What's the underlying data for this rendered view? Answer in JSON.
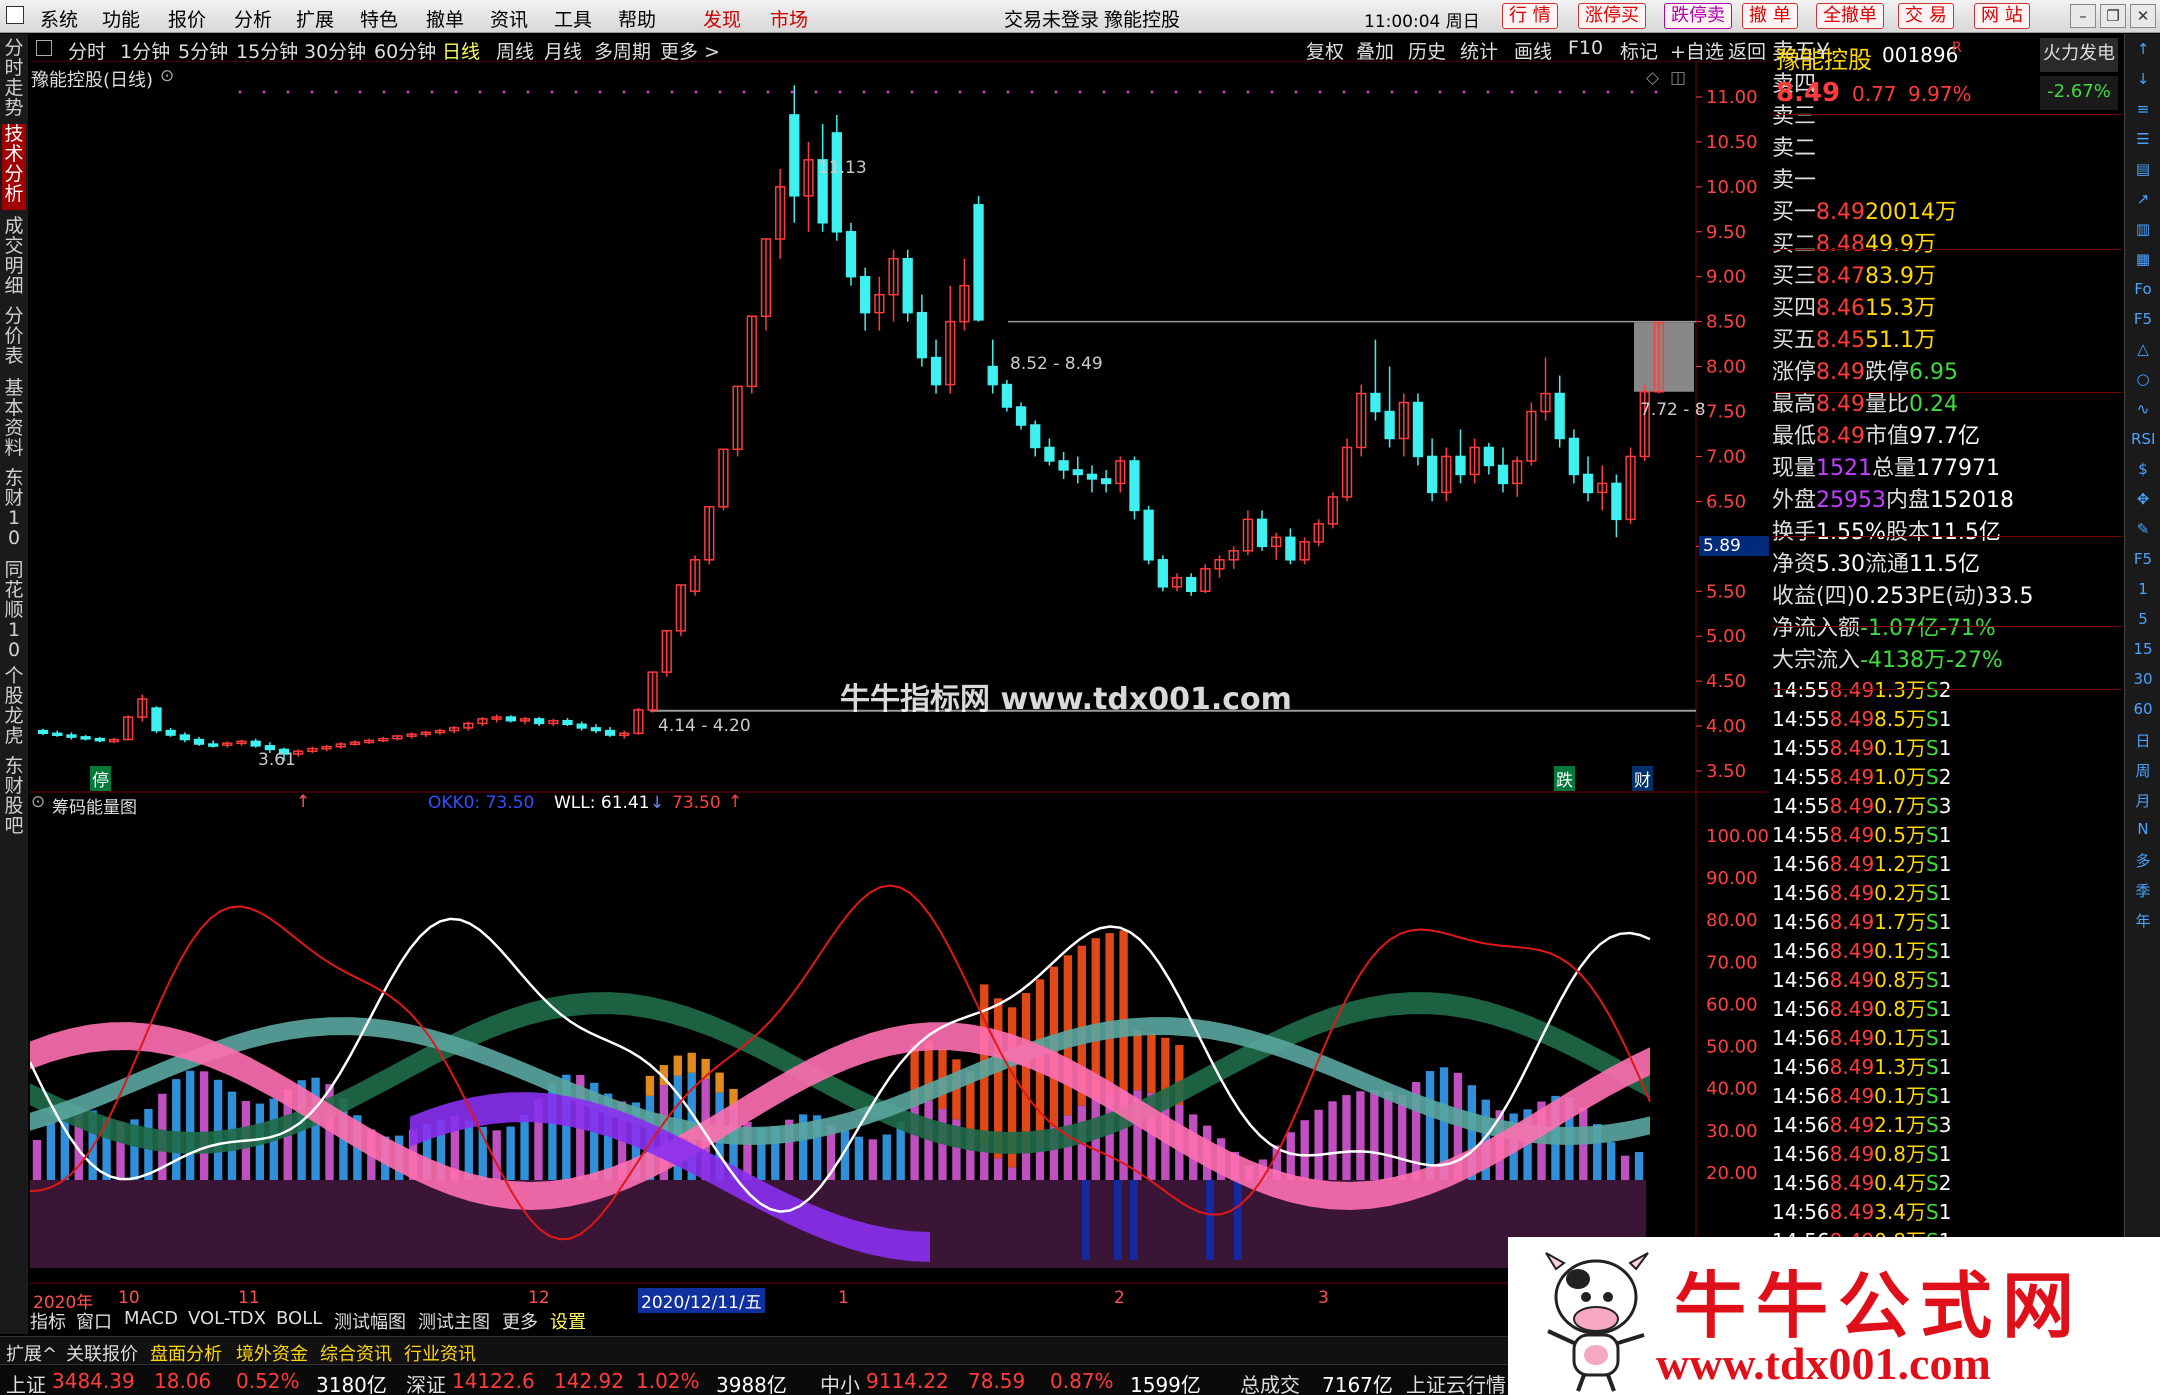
{
  "menu": {
    "items": [
      "系统",
      "功能",
      "报价",
      "分析",
      "扩展",
      "特色",
      "撤单",
      "资讯",
      "工具",
      "帮助"
    ],
    "discover": "发现",
    "market": "市场",
    "login": "交易未登录",
    "stock_name_title": "豫能控股",
    "clock": "11:00:04 周日",
    "quick": [
      "行 情",
      "涨停买",
      "跌停卖",
      "撤 单",
      "全撤单",
      "交 易",
      "网 站"
    ]
  },
  "leftbar": [
    "分时走势",
    "技术分析",
    "成交明细",
    "分价表",
    "基本资料",
    "东财10",
    "同花顺10",
    "个股龙虎",
    "东财股吧"
  ],
  "periods": [
    "分时",
    "1分钟",
    "5分钟",
    "15分钟",
    "30分钟",
    "60分钟",
    "日线",
    "周线",
    "月线",
    "多周期",
    "更多 >"
  ],
  "chart_tools": [
    "复权",
    "叠加",
    "历史",
    "统计",
    "画线",
    "F10",
    "标记",
    "+自选",
    "返回"
  ],
  "main_chart": {
    "title": "豫能控股(日线)",
    "ylabels": [
      "11.00",
      "10.50",
      "10.00",
      "9.50",
      "9.00",
      "8.50",
      "8.00",
      "7.50",
      "7.00",
      "6.50",
      "6.00",
      "5.50",
      "5.00",
      "4.50",
      "4.00",
      "3.50"
    ],
    "annotations": {
      "high": "11.13",
      "low": "3.61",
      "range1": "8.52 - 8.49",
      "range2": "4.14 - 4.20",
      "range3": "7.72 - 8",
      "marker": "5.89",
      "flag1": "停",
      "flag2": "跌",
      "flag3": "财"
    },
    "watermark": "牛牛指标网 www.tdx001.com"
  },
  "chart_data": {
    "type": "candlestick",
    "candles": [
      [
        3.95,
        3.97,
        3.9,
        3.92
      ],
      [
        3.92,
        3.95,
        3.88,
        3.9
      ],
      [
        3.9,
        3.93,
        3.85,
        3.88
      ],
      [
        3.88,
        3.9,
        3.84,
        3.86
      ],
      [
        3.86,
        3.88,
        3.82,
        3.84
      ],
      [
        3.84,
        3.87,
        3.81,
        3.85
      ],
      [
        3.85,
        4.12,
        3.84,
        4.1
      ],
      [
        4.1,
        4.35,
        4.05,
        4.3
      ],
      [
        4.2,
        4.22,
        3.92,
        3.95
      ],
      [
        3.95,
        3.98,
        3.88,
        3.9
      ],
      [
        3.9,
        3.93,
        3.82,
        3.85
      ],
      [
        3.85,
        3.88,
        3.78,
        3.8
      ],
      [
        3.8,
        3.84,
        3.76,
        3.79
      ],
      [
        3.79,
        3.83,
        3.76,
        3.81
      ],
      [
        3.81,
        3.85,
        3.78,
        3.83
      ],
      [
        3.83,
        3.86,
        3.76,
        3.78
      ],
      [
        3.78,
        3.82,
        3.7,
        3.74
      ],
      [
        3.74,
        3.76,
        3.61,
        3.69
      ],
      [
        3.69,
        3.74,
        3.66,
        3.72
      ],
      [
        3.72,
        3.77,
        3.7,
        3.75
      ],
      [
        3.75,
        3.79,
        3.72,
        3.77
      ],
      [
        3.77,
        3.82,
        3.75,
        3.8
      ],
      [
        3.8,
        3.84,
        3.78,
        3.82
      ],
      [
        3.82,
        3.86,
        3.8,
        3.84
      ],
      [
        3.84,
        3.88,
        3.82,
        3.86
      ],
      [
        3.86,
        3.9,
        3.84,
        3.89
      ],
      [
        3.89,
        3.93,
        3.86,
        3.91
      ],
      [
        3.91,
        3.95,
        3.88,
        3.93
      ],
      [
        3.93,
        3.97,
        3.9,
        3.95
      ],
      [
        3.95,
        4.0,
        3.92,
        3.98
      ],
      [
        3.98,
        4.05,
        3.95,
        4.03
      ],
      [
        4.03,
        4.1,
        4.0,
        4.08
      ],
      [
        4.08,
        4.13,
        4.04,
        4.1
      ],
      [
        4.1,
        4.12,
        4.04,
        4.06
      ],
      [
        4.06,
        4.1,
        4.02,
        4.08
      ],
      [
        4.08,
        4.1,
        4.0,
        4.03
      ],
      [
        4.03,
        4.08,
        4.0,
        4.06
      ],
      [
        4.06,
        4.09,
        4.0,
        4.02
      ],
      [
        4.02,
        4.05,
        3.95,
        3.98
      ],
      [
        3.98,
        4.02,
        3.92,
        3.95
      ],
      [
        3.95,
        3.99,
        3.88,
        3.9
      ],
      [
        3.9,
        3.95,
        3.86,
        3.92
      ],
      [
        3.92,
        4.2,
        3.9,
        4.18
      ],
      [
        4.18,
        4.6,
        4.15,
        4.6
      ],
      [
        4.6,
        5.06,
        4.55,
        5.06
      ],
      [
        5.06,
        5.57,
        5.0,
        5.57
      ],
      [
        5.5,
        5.9,
        5.45,
        5.85
      ],
      [
        5.85,
        6.44,
        5.8,
        6.44
      ],
      [
        6.44,
        7.08,
        6.4,
        7.08
      ],
      [
        7.08,
        7.78,
        7.0,
        7.78
      ],
      [
        7.78,
        8.56,
        7.7,
        8.56
      ],
      [
        8.56,
        9.42,
        8.4,
        9.42
      ],
      [
        9.42,
        10.2,
        9.2,
        10.0
      ],
      [
        10.8,
        11.13,
        9.6,
        9.9
      ],
      [
        9.9,
        10.5,
        9.5,
        10.3
      ],
      [
        10.3,
        10.7,
        9.5,
        9.6
      ],
      [
        10.6,
        10.8,
        9.4,
        9.5
      ],
      [
        9.5,
        9.6,
        8.9,
        9.0
      ],
      [
        9.0,
        9.1,
        8.4,
        8.6
      ],
      [
        8.6,
        9.0,
        8.4,
        8.8
      ],
      [
        8.8,
        9.3,
        8.5,
        9.2
      ],
      [
        9.2,
        9.3,
        8.5,
        8.6
      ],
      [
        8.6,
        8.8,
        8.0,
        8.1
      ],
      [
        8.1,
        8.3,
        7.7,
        7.8
      ],
      [
        7.8,
        8.9,
        7.7,
        8.5
      ],
      [
        8.5,
        9.2,
        8.4,
        8.9
      ],
      [
        9.8,
        9.9,
        8.5,
        8.52
      ],
      [
        8.0,
        8.3,
        7.7,
        7.8
      ],
      [
        7.8,
        7.85,
        7.5,
        7.55
      ],
      [
        7.55,
        7.6,
        7.3,
        7.35
      ],
      [
        7.35,
        7.4,
        7.0,
        7.1
      ],
      [
        7.1,
        7.2,
        6.9,
        6.95
      ],
      [
        6.95,
        7.05,
        6.75,
        6.85
      ],
      [
        6.85,
        7.0,
        6.7,
        6.8
      ],
      [
        6.8,
        6.9,
        6.6,
        6.75
      ],
      [
        6.75,
        6.85,
        6.6,
        6.7
      ],
      [
        6.7,
        7.0,
        6.6,
        6.95
      ],
      [
        6.95,
        7.0,
        6.3,
        6.4
      ],
      [
        6.4,
        6.45,
        5.8,
        5.85
      ],
      [
        5.85,
        5.9,
        5.5,
        5.55
      ],
      [
        5.55,
        5.7,
        5.5,
        5.65
      ],
      [
        5.65,
        5.7,
        5.45,
        5.5
      ],
      [
        5.5,
        5.8,
        5.48,
        5.75
      ],
      [
        5.75,
        5.9,
        5.65,
        5.85
      ],
      [
        5.85,
        6.0,
        5.75,
        5.95
      ],
      [
        5.95,
        6.4,
        5.9,
        6.3
      ],
      [
        6.3,
        6.4,
        5.95,
        6.0
      ],
      [
        6.0,
        6.15,
        5.85,
        6.1
      ],
      [
        6.1,
        6.2,
        5.8,
        5.85
      ],
      [
        5.85,
        6.1,
        5.8,
        6.05
      ],
      [
        6.05,
        6.3,
        6.0,
        6.25
      ],
      [
        6.25,
        6.6,
        6.2,
        6.55
      ],
      [
        6.55,
        7.2,
        6.5,
        7.1
      ],
      [
        7.1,
        7.8,
        7.0,
        7.7
      ],
      [
        7.7,
        8.3,
        7.4,
        7.5
      ],
      [
        7.5,
        8.0,
        7.1,
        7.2
      ],
      [
        7.2,
        7.7,
        7.0,
        7.6
      ],
      [
        7.6,
        7.7,
        6.9,
        7.0
      ],
      [
        7.0,
        7.2,
        6.5,
        6.6
      ],
      [
        6.6,
        7.1,
        6.5,
        7.0
      ],
      [
        7.0,
        7.3,
        6.7,
        6.8
      ],
      [
        6.8,
        7.2,
        6.7,
        7.1
      ],
      [
        7.1,
        7.15,
        6.8,
        6.9
      ],
      [
        6.9,
        7.1,
        6.6,
        6.7
      ],
      [
        6.7,
        7.0,
        6.55,
        6.95
      ],
      [
        6.95,
        7.6,
        6.9,
        7.5
      ],
      [
        7.5,
        8.1,
        7.4,
        7.7
      ],
      [
        7.7,
        7.9,
        7.1,
        7.2
      ],
      [
        7.2,
        7.3,
        6.7,
        6.8
      ],
      [
        6.8,
        7.0,
        6.5,
        6.6
      ],
      [
        6.6,
        6.9,
        6.4,
        6.7
      ],
      [
        6.7,
        6.8,
        6.1,
        6.3
      ],
      [
        6.3,
        7.1,
        6.25,
        7.0
      ],
      [
        7.0,
        7.8,
        6.95,
        7.72
      ],
      [
        7.72,
        8.49,
        7.7,
        8.49
      ]
    ],
    "ylim": [
      3.4,
      11.3
    ],
    "yticks": [
      3.5,
      4.0,
      4.5,
      5.0,
      5.5,
      6.0,
      6.5,
      7.0,
      7.5,
      8.0,
      8.5,
      9.0,
      9.5,
      10.0,
      10.5,
      11.0
    ]
  },
  "sub_chart": {
    "title": "筹码能量图",
    "okko": "OKK0: 73.50",
    "wll": "WLL: 61.41",
    "val3": "73.50",
    "ylabels": [
      "100.00",
      "90.00",
      "80.00",
      "70.00",
      "60.00",
      "50.00",
      "40.00",
      "30.00",
      "20.00"
    ]
  },
  "xaxis": {
    "labels": [
      "2020年",
      "10",
      "11",
      "12",
      "2020/12/11/五",
      "1",
      "2",
      "3"
    ]
  },
  "bottom_tabs": [
    "指标",
    "窗口",
    "MACD",
    "VOL-TDX",
    "BOLL",
    "测试幅图",
    "测试主图",
    "更多",
    "设置"
  ],
  "right": {
    "stock_name": "豫能控股",
    "code": "001896",
    "r": "R",
    "mode": "火力发电",
    "price": "8.49",
    "change": "0.77",
    "pct": "9.97%",
    "mode_pct": "-2.67%",
    "asks": [
      {
        "label": "卖五",
        "extra": "¥"
      },
      {
        "label": "卖四",
        "extra": ""
      },
      {
        "label": "卖三",
        "extra": ""
      },
      {
        "label": "卖二",
        "extra": ""
      },
      {
        "label": "卖一",
        "extra": ""
      }
    ],
    "bids": [
      {
        "label": "买一",
        "price": "8.49",
        "vol": "20014万"
      },
      {
        "label": "买二",
        "price": "8.48",
        "vol": "49.9万"
      },
      {
        "label": "买三",
        "price": "8.47",
        "vol": "83.9万"
      },
      {
        "label": "买四",
        "price": "8.46",
        "vol": "15.3万"
      },
      {
        "label": "买五",
        "price": "8.45",
        "vol": "51.1万"
      }
    ],
    "stats": [
      {
        "k1": "涨停",
        "v1": "8.49",
        "k2": "跌停",
        "v2": "6.95"
      },
      {
        "k1": "最高",
        "v1": "8.49",
        "k2": "量比",
        "v2": "0.24"
      },
      {
        "k1": "最低",
        "v1": "8.49",
        "k2": "市值",
        "v2": "97.7亿"
      },
      {
        "k1": "现量",
        "v1": "1521",
        "k2": "总量",
        "v2": "177971"
      },
      {
        "k1": "外盘",
        "v1": "25953",
        "k2": "内盘",
        "v2": "152018"
      }
    ],
    "stats2": [
      {
        "k1": "换手",
        "v1": "1.55%",
        "k2": "股本",
        "v2": "11.5亿"
      },
      {
        "k1": "净资",
        "v1": "5.30",
        "k2": "流通",
        "v2": "11.5亿"
      },
      {
        "k1": "收益(四)",
        "v1": "0.253",
        "k2": "PE(动)",
        "v2": "33.5"
      }
    ],
    "flows": [
      {
        "k": "净流入额",
        "v": "-1.07亿",
        "p": "-71%",
        "bar": 0.72
      },
      {
        "k": "大宗流入",
        "v": "-4138万",
        "p": "-27%",
        "bar": 0.27
      }
    ],
    "ticks": [
      [
        "14:55",
        "8.49",
        "1.3万",
        "S",
        "2"
      ],
      [
        "14:55",
        "8.49",
        "8.5万",
        "S",
        "1"
      ],
      [
        "14:55",
        "8.49",
        "0.1万",
        "S",
        "1"
      ],
      [
        "14:55",
        "8.49",
        "1.0万",
        "S",
        "2"
      ],
      [
        "14:55",
        "8.49",
        "0.7万",
        "S",
        "3"
      ],
      [
        "14:55",
        "8.49",
        "0.5万",
        "S",
        "1"
      ],
      [
        "14:56",
        "8.49",
        "1.2万",
        "S",
        "1"
      ],
      [
        "14:56",
        "8.49",
        "0.2万",
        "S",
        "1"
      ],
      [
        "14:56",
        "8.49",
        "1.7万",
        "S",
        "1"
      ],
      [
        "14:56",
        "8.49",
        "0.1万",
        "S",
        "1"
      ],
      [
        "14:56",
        "8.49",
        "0.8万",
        "S",
        "1"
      ],
      [
        "14:56",
        "8.49",
        "0.8万",
        "S",
        "1"
      ],
      [
        "14:56",
        "8.49",
        "0.1万",
        "S",
        "1"
      ],
      [
        "14:56",
        "8.49",
        "1.3万",
        "S",
        "1"
      ],
      [
        "14:56",
        "8.49",
        "0.1万",
        "S",
        "1"
      ],
      [
        "14:56",
        "8.49",
        "2.1万",
        "S",
        "3"
      ],
      [
        "14:56",
        "8.49",
        "0.8万",
        "S",
        "1"
      ],
      [
        "14:56",
        "8.49",
        "0.4万",
        "S",
        "2"
      ],
      [
        "14:56",
        "8.49",
        "3.4万",
        "S",
        "1"
      ],
      [
        "14:56",
        "8.49",
        "0.8万",
        "S",
        "1"
      ]
    ]
  },
  "rsidebar": [
    "↑",
    "↓",
    "≡",
    "☰",
    "▤",
    "↗",
    "▥",
    "▦",
    "Fo",
    "F5",
    "△",
    "○",
    "∿",
    "RSI",
    "$",
    "✥",
    "✎",
    "F5",
    "1",
    "5",
    "15",
    "30",
    "60",
    "日",
    "周",
    "月",
    "N",
    "多",
    "季",
    "年"
  ],
  "status1": [
    "扩展^",
    "关联报价",
    "盘面分析",
    "境外资金",
    "综合资讯",
    "行业资讯"
  ],
  "status2": [
    {
      "k": "上证",
      "v": "3484.39",
      "c": "18.06",
      "p": "0.52%",
      "a": "3180亿"
    },
    {
      "k": "深证",
      "v": "14122.6",
      "c": "142.92",
      "p": "1.02%",
      "a": "3988亿"
    },
    {
      "k": "中小",
      "v": "9114.22",
      "c": "78.59",
      "p": "0.87%",
      "a": "1599亿"
    }
  ],
  "status2_extra": {
    "k": "总成交",
    "v": "7167亿",
    "tail": "上证云行情"
  },
  "logo": {
    "title": "牛牛公式网",
    "url": "www.tdx001.com"
  },
  "colors": {
    "up": "#ff3b3b",
    "down": "#3ff0f0",
    "bg": "#000000"
  }
}
